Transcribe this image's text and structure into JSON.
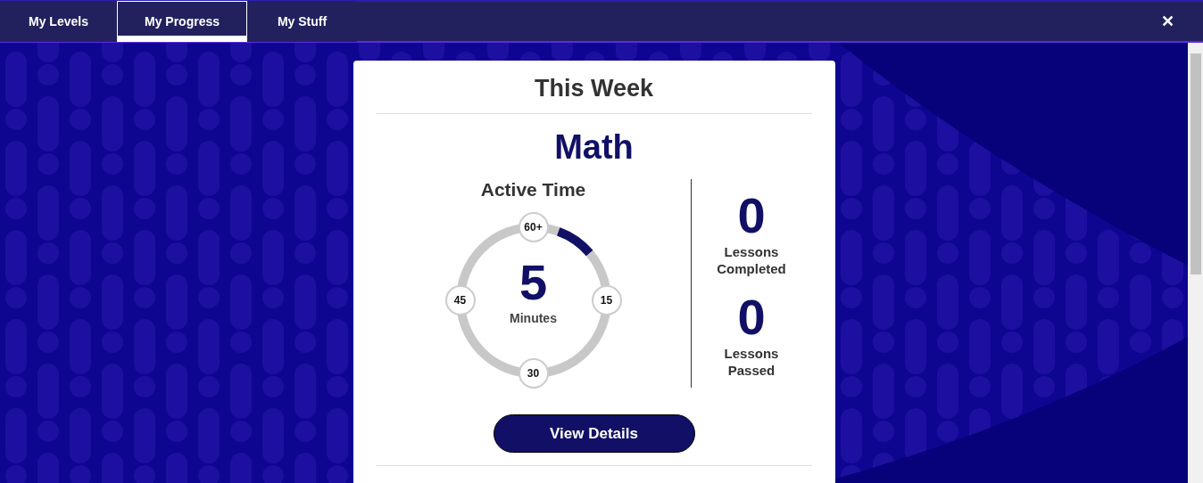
{
  "tabs": [
    {
      "label": "My Levels",
      "selected": false
    },
    {
      "label": "My Progress",
      "selected": true
    },
    {
      "label": "My Stuff",
      "selected": false
    }
  ],
  "close": {
    "label": "✕"
  },
  "card": {
    "title": "This Week",
    "subject": "Math",
    "active_time": {
      "title": "Active Time",
      "value": "5",
      "unit": "Minutes",
      "level": 0.083,
      "ticks": [
        {
          "label": "60+"
        },
        {
          "label": "15"
        },
        {
          "label": "30"
        },
        {
          "label": "45"
        }
      ]
    },
    "stats": [
      {
        "value": "0",
        "label": "Lessons Completed"
      },
      {
        "value": "0",
        "label": "Lessons Passed"
      }
    ],
    "button": "View Details"
  }
}
